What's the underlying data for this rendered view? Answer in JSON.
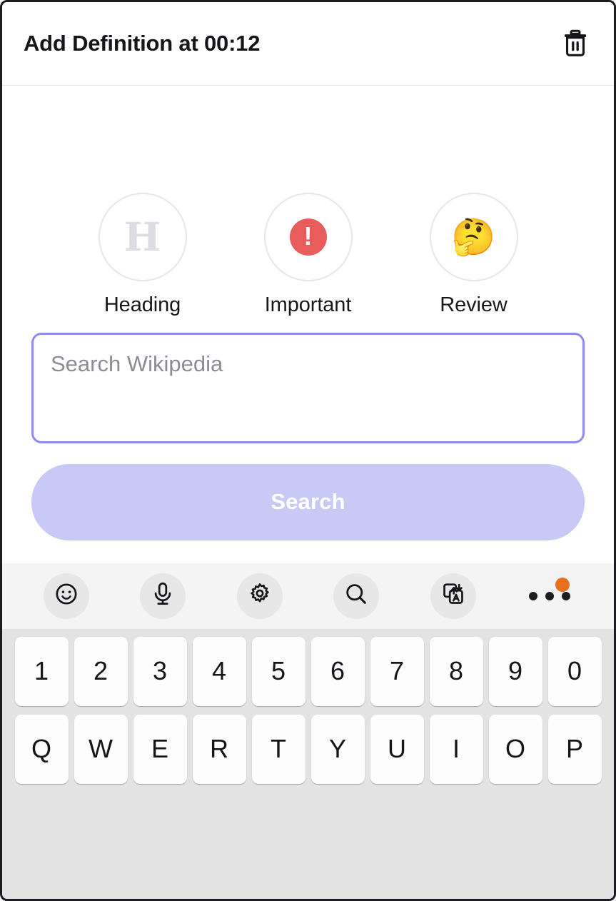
{
  "header": {
    "title": "Add Definition at 00:12",
    "delete_icon": "trash-icon"
  },
  "quick_actions": [
    {
      "label": "Heading",
      "icon": "heading-h-icon",
      "glyph": "H",
      "color": "#dcdce3"
    },
    {
      "label": "Important",
      "icon": "important-alert-icon",
      "glyph": "!",
      "color": "#e85c5c"
    },
    {
      "label": "Review",
      "icon": "thinking-face-icon",
      "glyph": "🤔",
      "color": "#e8963c"
    }
  ],
  "search": {
    "placeholder": "Search Wikipedia",
    "value": "",
    "button_label": "Search",
    "border_color": "#8c8cf0",
    "button_color": "#c9c9f5"
  },
  "keyboard": {
    "toolbar": [
      {
        "name": "emoji-icon",
        "label": "Emoji"
      },
      {
        "name": "microphone-icon",
        "label": "Voice input"
      },
      {
        "name": "gear-icon",
        "label": "Settings"
      },
      {
        "name": "search-icon",
        "label": "Search"
      },
      {
        "name": "translate-icon",
        "label": "Translate"
      },
      {
        "name": "more-icon",
        "label": "More",
        "badge_color": "#e8701f"
      }
    ],
    "rows": [
      [
        "1",
        "2",
        "3",
        "4",
        "5",
        "6",
        "7",
        "8",
        "9",
        "0"
      ],
      [
        "Q",
        "W",
        "E",
        "R",
        "T",
        "Y",
        "U",
        "I",
        "O",
        "P"
      ]
    ]
  }
}
